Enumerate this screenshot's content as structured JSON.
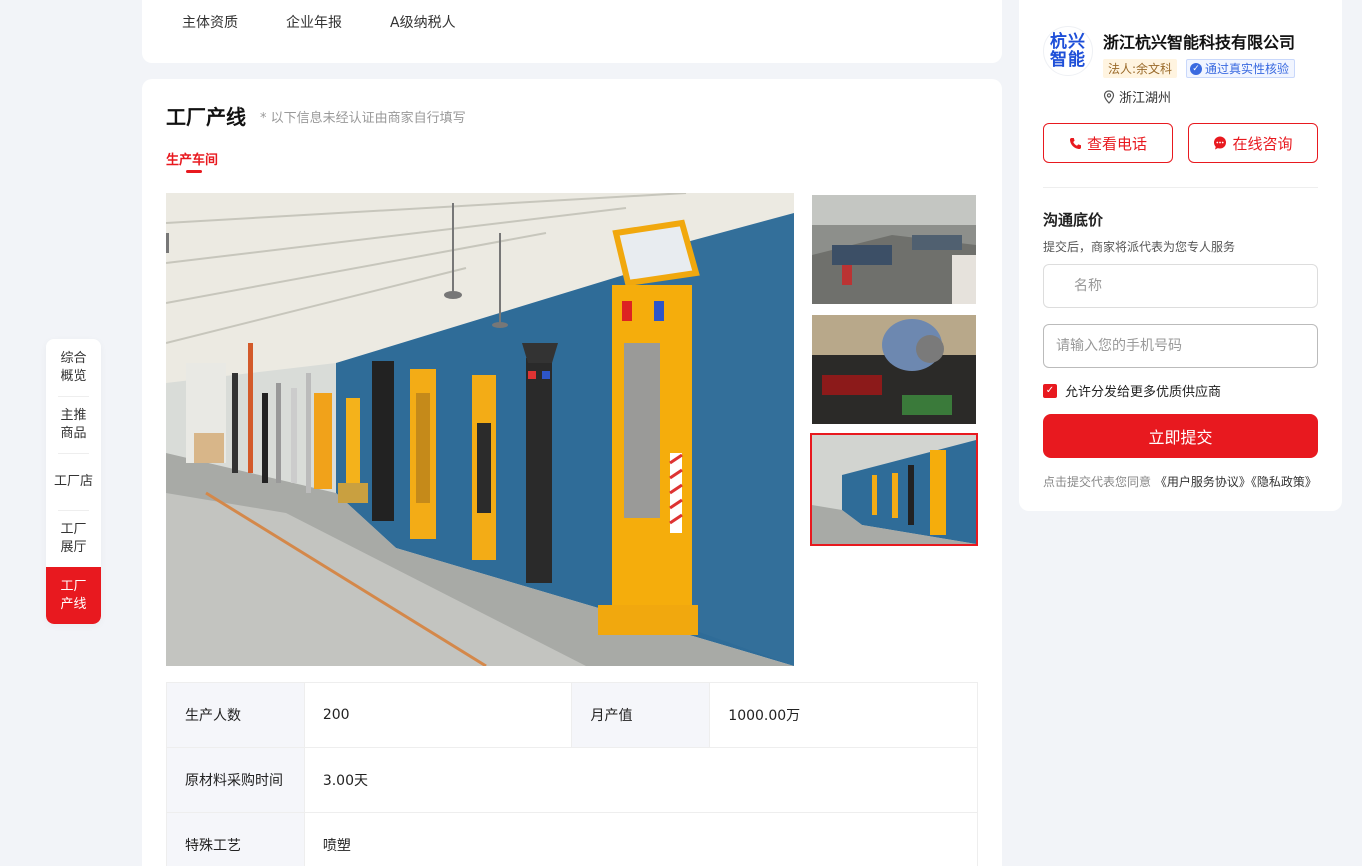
{
  "top_tabs": [
    "主体资质",
    "企业年报",
    "A级纳税人"
  ],
  "side_nav": [
    {
      "label": "综合\n概览",
      "active": false
    },
    {
      "label": "主推\n商品",
      "active": false
    },
    {
      "label": "工厂店",
      "active": false
    },
    {
      "label": "工厂\n展厅",
      "active": false
    },
    {
      "label": "工厂\n产线",
      "active": true
    }
  ],
  "section": {
    "title": "工厂产线",
    "note": "* 以下信息未经认证由商家自行填写",
    "sub_tab": "生产车间"
  },
  "info_table": {
    "row1": {
      "label1": "生产人数",
      "value1": "200",
      "label2": "月产值",
      "value2": "1000.00万"
    },
    "row2": {
      "label": "原材料采购时间",
      "value": "3.00天"
    },
    "row3": {
      "label": "特殊工艺",
      "value": "喷塑"
    }
  },
  "company": {
    "logo_text_line1": "杭兴",
    "logo_text_line2": "智能",
    "name": "浙江杭兴智能科技有限公司",
    "legal_badge": "法人:余文科",
    "verified_badge": "通过真实性核验",
    "location": "浙江湖州"
  },
  "actions": {
    "call_label": "查看电话",
    "chat_label": "在线咨询"
  },
  "form": {
    "title": "沟通底价",
    "note": "提交后，商家将派代表为您专人服务",
    "name_placeholder": "名称",
    "phone_placeholder": "请输入您的手机号码",
    "checkbox_label": "允许分发给更多优质供应商",
    "submit_label": "立即提交",
    "agree_prefix": "点击提交代表您同意",
    "agree_link1": "《用户服务协议》",
    "agree_link2": "《隐私政策》"
  },
  "colors": {
    "accent": "#e8191f",
    "verified": "#3a6ae0",
    "page_bg": "#f2f4f8"
  }
}
